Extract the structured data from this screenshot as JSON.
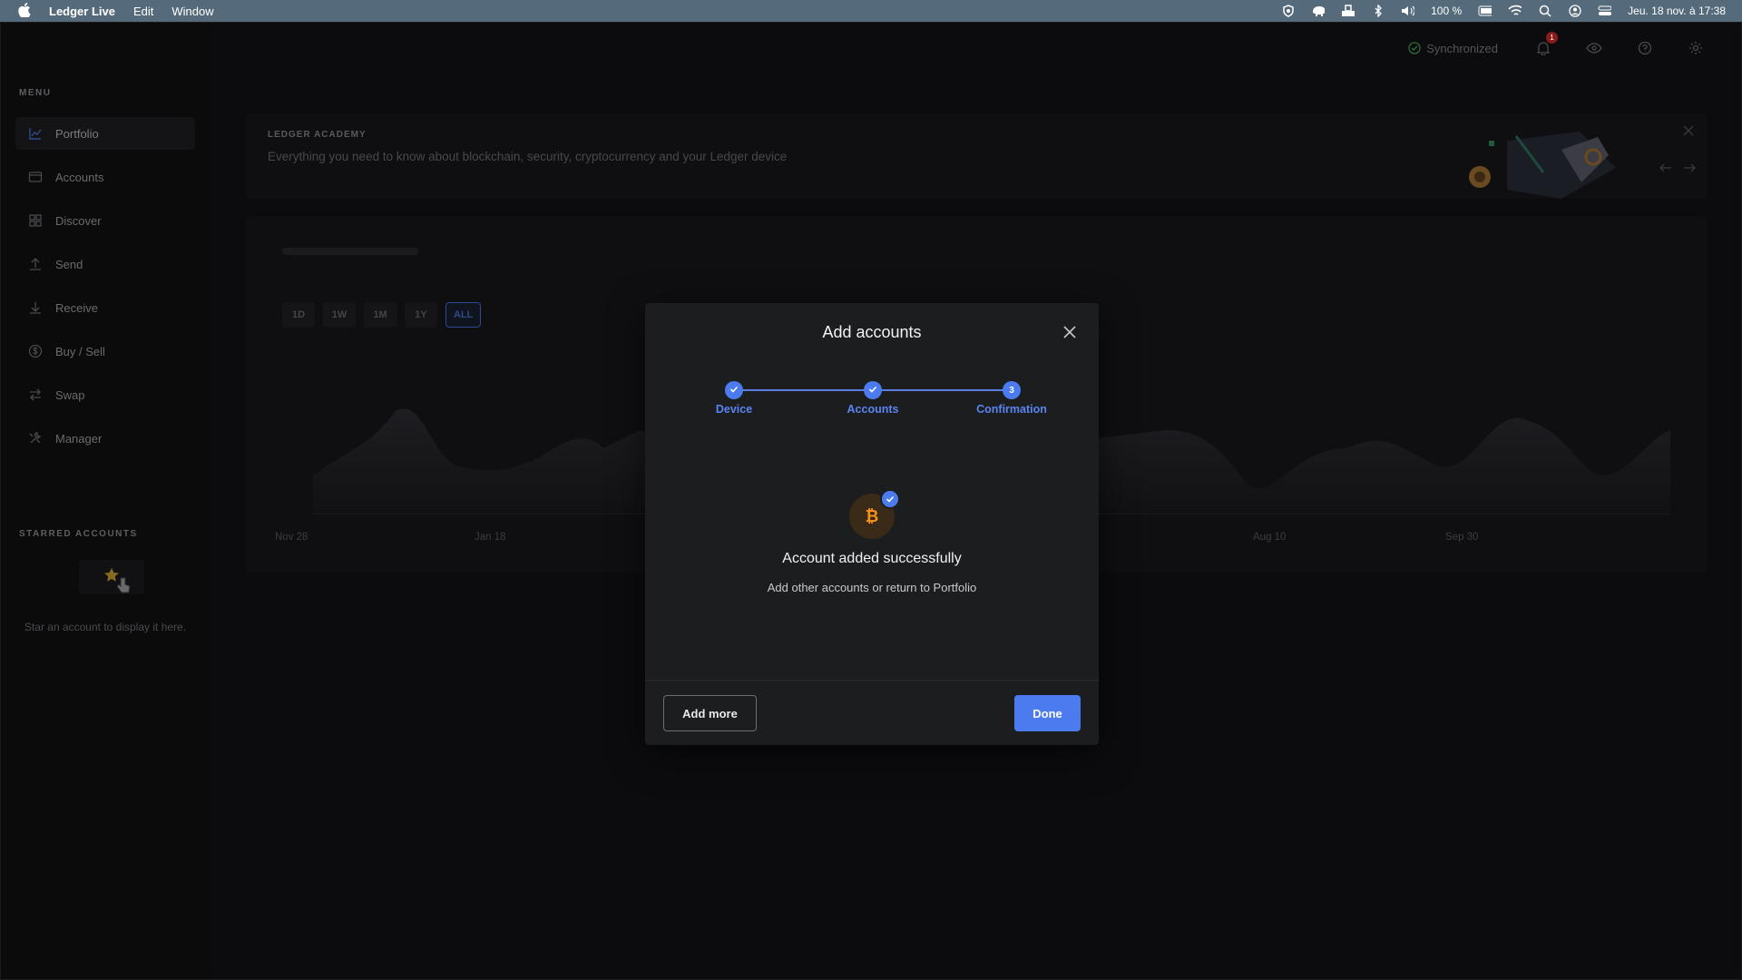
{
  "menubar": {
    "app_name": "Ledger Live",
    "menus": [
      "Edit",
      "Window"
    ],
    "battery": "100 %",
    "datetime": "Jeu. 18 nov. à 17:38"
  },
  "sidebar": {
    "menu_label": "MENU",
    "items": [
      {
        "label": "Portfolio",
        "icon": "chart-icon",
        "active": true
      },
      {
        "label": "Accounts",
        "icon": "wallet-icon"
      },
      {
        "label": "Discover",
        "icon": "grid-icon"
      },
      {
        "label": "Send",
        "icon": "send-icon"
      },
      {
        "label": "Receive",
        "icon": "receive-icon"
      },
      {
        "label": "Buy / Sell",
        "icon": "dollar-icon"
      },
      {
        "label": "Swap",
        "icon": "swap-icon"
      },
      {
        "label": "Manager",
        "icon": "tools-icon"
      }
    ],
    "starred_label": "STARRED ACCOUNTS",
    "starred_empty": "Star an account to display it here."
  },
  "topbar": {
    "sync_status": "Synchronized",
    "notification_count": "1"
  },
  "academy": {
    "title": "LEDGER ACADEMY",
    "description": "Everything you need to know about blockchain, security, cryptocurrency and your Ledger device"
  },
  "chart": {
    "ranges": [
      "1D",
      "1W",
      "1M",
      "1Y",
      "ALL"
    ],
    "active_range": "ALL",
    "x_labels": [
      "Nov 28",
      "Jan 18",
      "Aug 10",
      "Sep 30"
    ]
  },
  "modal": {
    "title": "Add accounts",
    "steps": [
      {
        "label": "Device",
        "state": "done"
      },
      {
        "label": "Accounts",
        "state": "done"
      },
      {
        "label": "Confirmation",
        "state": "current",
        "number": "3"
      }
    ],
    "coin_icon": "bitcoin-icon",
    "success_title": "Account added successfully",
    "success_sub": "Add other accounts or return to Portfolio",
    "add_more": "Add more",
    "done": "Done"
  },
  "colors": {
    "accent": "#4c7bf0",
    "bitcoin": "#f7931a",
    "menubar": "#556b7b",
    "close_red": "#fe5f57",
    "minimize_yellow": "#febc2e",
    "maximize_green": "#28c840"
  }
}
